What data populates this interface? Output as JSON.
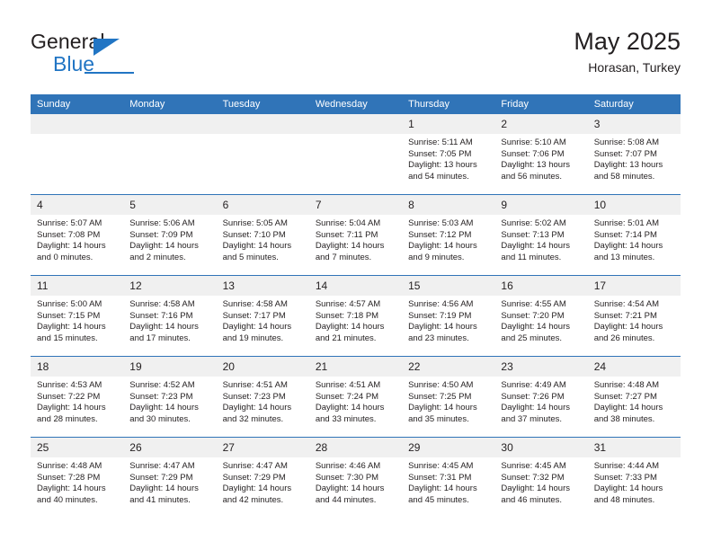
{
  "brand": {
    "name_top": "General",
    "name_bottom": "Blue",
    "accent_color": "#2175c4"
  },
  "header": {
    "title": "May 2025",
    "subtitle": "Horasan, Turkey",
    "header_bg": "#3074b8",
    "daynum_bg": "#f0f0f0"
  },
  "weekdays": [
    "Sunday",
    "Monday",
    "Tuesday",
    "Wednesday",
    "Thursday",
    "Friday",
    "Saturday"
  ],
  "weeks": [
    [
      {
        "day": "",
        "empty": true
      },
      {
        "day": "",
        "empty": true
      },
      {
        "day": "",
        "empty": true
      },
      {
        "day": "",
        "empty": true
      },
      {
        "day": "1",
        "sunrise": "Sunrise: 5:11 AM",
        "sunset": "Sunset: 7:05 PM",
        "daylight": "Daylight: 13 hours and 54 minutes."
      },
      {
        "day": "2",
        "sunrise": "Sunrise: 5:10 AM",
        "sunset": "Sunset: 7:06 PM",
        "daylight": "Daylight: 13 hours and 56 minutes."
      },
      {
        "day": "3",
        "sunrise": "Sunrise: 5:08 AM",
        "sunset": "Sunset: 7:07 PM",
        "daylight": "Daylight: 13 hours and 58 minutes."
      }
    ],
    [
      {
        "day": "4",
        "sunrise": "Sunrise: 5:07 AM",
        "sunset": "Sunset: 7:08 PM",
        "daylight": "Daylight: 14 hours and 0 minutes."
      },
      {
        "day": "5",
        "sunrise": "Sunrise: 5:06 AM",
        "sunset": "Sunset: 7:09 PM",
        "daylight": "Daylight: 14 hours and 2 minutes."
      },
      {
        "day": "6",
        "sunrise": "Sunrise: 5:05 AM",
        "sunset": "Sunset: 7:10 PM",
        "daylight": "Daylight: 14 hours and 5 minutes."
      },
      {
        "day": "7",
        "sunrise": "Sunrise: 5:04 AM",
        "sunset": "Sunset: 7:11 PM",
        "daylight": "Daylight: 14 hours and 7 minutes."
      },
      {
        "day": "8",
        "sunrise": "Sunrise: 5:03 AM",
        "sunset": "Sunset: 7:12 PM",
        "daylight": "Daylight: 14 hours and 9 minutes."
      },
      {
        "day": "9",
        "sunrise": "Sunrise: 5:02 AM",
        "sunset": "Sunset: 7:13 PM",
        "daylight": "Daylight: 14 hours and 11 minutes."
      },
      {
        "day": "10",
        "sunrise": "Sunrise: 5:01 AM",
        "sunset": "Sunset: 7:14 PM",
        "daylight": "Daylight: 14 hours and 13 minutes."
      }
    ],
    [
      {
        "day": "11",
        "sunrise": "Sunrise: 5:00 AM",
        "sunset": "Sunset: 7:15 PM",
        "daylight": "Daylight: 14 hours and 15 minutes."
      },
      {
        "day": "12",
        "sunrise": "Sunrise: 4:58 AM",
        "sunset": "Sunset: 7:16 PM",
        "daylight": "Daylight: 14 hours and 17 minutes."
      },
      {
        "day": "13",
        "sunrise": "Sunrise: 4:58 AM",
        "sunset": "Sunset: 7:17 PM",
        "daylight": "Daylight: 14 hours and 19 minutes."
      },
      {
        "day": "14",
        "sunrise": "Sunrise: 4:57 AM",
        "sunset": "Sunset: 7:18 PM",
        "daylight": "Daylight: 14 hours and 21 minutes."
      },
      {
        "day": "15",
        "sunrise": "Sunrise: 4:56 AM",
        "sunset": "Sunset: 7:19 PM",
        "daylight": "Daylight: 14 hours and 23 minutes."
      },
      {
        "day": "16",
        "sunrise": "Sunrise: 4:55 AM",
        "sunset": "Sunset: 7:20 PM",
        "daylight": "Daylight: 14 hours and 25 minutes."
      },
      {
        "day": "17",
        "sunrise": "Sunrise: 4:54 AM",
        "sunset": "Sunset: 7:21 PM",
        "daylight": "Daylight: 14 hours and 26 minutes."
      }
    ],
    [
      {
        "day": "18",
        "sunrise": "Sunrise: 4:53 AM",
        "sunset": "Sunset: 7:22 PM",
        "daylight": "Daylight: 14 hours and 28 minutes."
      },
      {
        "day": "19",
        "sunrise": "Sunrise: 4:52 AM",
        "sunset": "Sunset: 7:23 PM",
        "daylight": "Daylight: 14 hours and 30 minutes."
      },
      {
        "day": "20",
        "sunrise": "Sunrise: 4:51 AM",
        "sunset": "Sunset: 7:23 PM",
        "daylight": "Daylight: 14 hours and 32 minutes."
      },
      {
        "day": "21",
        "sunrise": "Sunrise: 4:51 AM",
        "sunset": "Sunset: 7:24 PM",
        "daylight": "Daylight: 14 hours and 33 minutes."
      },
      {
        "day": "22",
        "sunrise": "Sunrise: 4:50 AM",
        "sunset": "Sunset: 7:25 PM",
        "daylight": "Daylight: 14 hours and 35 minutes."
      },
      {
        "day": "23",
        "sunrise": "Sunrise: 4:49 AM",
        "sunset": "Sunset: 7:26 PM",
        "daylight": "Daylight: 14 hours and 37 minutes."
      },
      {
        "day": "24",
        "sunrise": "Sunrise: 4:48 AM",
        "sunset": "Sunset: 7:27 PM",
        "daylight": "Daylight: 14 hours and 38 minutes."
      }
    ],
    [
      {
        "day": "25",
        "sunrise": "Sunrise: 4:48 AM",
        "sunset": "Sunset: 7:28 PM",
        "daylight": "Daylight: 14 hours and 40 minutes."
      },
      {
        "day": "26",
        "sunrise": "Sunrise: 4:47 AM",
        "sunset": "Sunset: 7:29 PM",
        "daylight": "Daylight: 14 hours and 41 minutes."
      },
      {
        "day": "27",
        "sunrise": "Sunrise: 4:47 AM",
        "sunset": "Sunset: 7:29 PM",
        "daylight": "Daylight: 14 hours and 42 minutes."
      },
      {
        "day": "28",
        "sunrise": "Sunrise: 4:46 AM",
        "sunset": "Sunset: 7:30 PM",
        "daylight": "Daylight: 14 hours and 44 minutes."
      },
      {
        "day": "29",
        "sunrise": "Sunrise: 4:45 AM",
        "sunset": "Sunset: 7:31 PM",
        "daylight": "Daylight: 14 hours and 45 minutes."
      },
      {
        "day": "30",
        "sunrise": "Sunrise: 4:45 AM",
        "sunset": "Sunset: 7:32 PM",
        "daylight": "Daylight: 14 hours and 46 minutes."
      },
      {
        "day": "31",
        "sunrise": "Sunrise: 4:44 AM",
        "sunset": "Sunset: 7:33 PM",
        "daylight": "Daylight: 14 hours and 48 minutes."
      }
    ]
  ]
}
